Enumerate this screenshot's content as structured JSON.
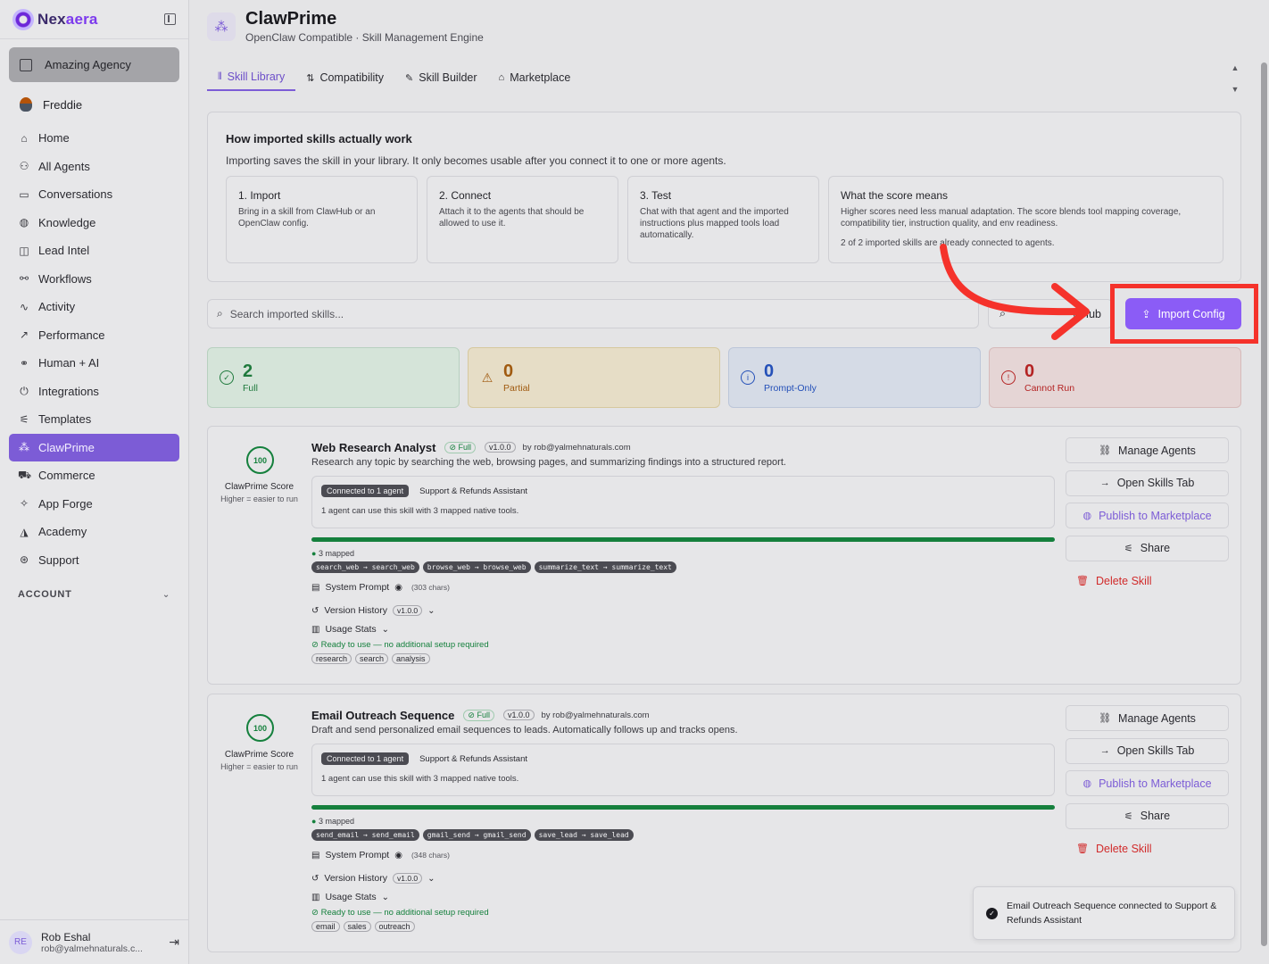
{
  "brand": {
    "name_part1": "Nex",
    "name_part2": "aera"
  },
  "workspace": "Amazing Agency",
  "user": "Freddie",
  "nav": [
    {
      "label": "Home",
      "icon": "⌂"
    },
    {
      "label": "All Agents",
      "icon": "⚇"
    },
    {
      "label": "Conversations",
      "icon": "▭"
    },
    {
      "label": "Knowledge",
      "icon": "◍"
    },
    {
      "label": "Lead Intel",
      "icon": "◫"
    },
    {
      "label": "Workflows",
      "icon": "⚯"
    },
    {
      "label": "Activity",
      "icon": "∿"
    },
    {
      "label": "Performance",
      "icon": "↗"
    },
    {
      "label": "Human + AI",
      "icon": "⚭"
    },
    {
      "label": "Integrations",
      "icon": "⏻"
    },
    {
      "label": "Templates",
      "icon": "⚟"
    },
    {
      "label": "ClawPrime",
      "icon": "⁂"
    },
    {
      "label": "Commerce",
      "icon": "⛟"
    },
    {
      "label": "App Forge",
      "icon": "✧"
    },
    {
      "label": "Academy",
      "icon": "◮"
    },
    {
      "label": "Support",
      "icon": "⊛"
    }
  ],
  "account_label": "ACCOUNT",
  "footer": {
    "initials": "RE",
    "name": "Rob Eshal",
    "email": "rob@yalmehnaturals.c..."
  },
  "page": {
    "title": "ClawPrime",
    "subtitle": "OpenClaw Compatible · Skill Management Engine"
  },
  "tabs": [
    "Skill Library",
    "Compatibility",
    "Skill Builder",
    "Marketplace"
  ],
  "info": {
    "title": "How imported skills actually work",
    "desc": "Importing saves the skill in your library. It only becomes usable after you connect it to one or more agents.",
    "steps": [
      {
        "title": "1. Import",
        "desc": "Bring in a skill from ClawHub or an OpenClaw config."
      },
      {
        "title": "2. Connect",
        "desc": "Attach it to the agents that should be allowed to use it."
      },
      {
        "title": "3. Test",
        "desc": "Chat with that agent and the imported instructions plus mapped tools load automatically."
      },
      {
        "title": "What the score means",
        "desc": "Higher scores need less manual adaptation. The score blends tool mapping coverage, compatibility tier, instruction quality, and env readiness.",
        "extra": "2 of 2 imported skills are already connected to agents."
      }
    ]
  },
  "search_placeholder": "Search imported skills...",
  "clawhub_label": "wHub",
  "import_label": "Import Config",
  "stats": [
    {
      "value": "2",
      "label": "Full"
    },
    {
      "value": "0",
      "label": "Partial"
    },
    {
      "value": "0",
      "label": "Prompt-Only"
    },
    {
      "value": "0",
      "label": "Cannot Run"
    }
  ],
  "skills": [
    {
      "score": "100",
      "score_label": "ClawPrime Score",
      "score_sub": "Higher = easier to run",
      "name": "Web Research Analyst",
      "tier": "Full",
      "version": "v1.0.0",
      "by": "by rob@yalmehnaturals.com",
      "desc": "Research any topic by searching the web, browsing pages, and summarizing findings into a structured report.",
      "connected": "Connected to 1 agent",
      "agent": "Support & Refunds Assistant",
      "note": "1 agent can use this skill with 3 mapped native tools.",
      "progress": 1.0,
      "mapped": "3 mapped",
      "tools": [
        "search_web → search_web",
        "browse_web → browse_web",
        "summarize_text → summarize_text"
      ],
      "system_prompt": "System Prompt",
      "chars": "(303 chars)",
      "version_history": "Version History",
      "usage_stats": "Usage Stats",
      "ready": "Ready to use — no additional setup required",
      "tags": [
        "research",
        "search",
        "analysis"
      ]
    },
    {
      "score": "100",
      "score_label": "ClawPrime Score",
      "score_sub": "Higher = easier to run",
      "name": "Email Outreach Sequence",
      "tier": "Full",
      "version": "v1.0.0",
      "by": "by rob@yalmehnaturals.com",
      "desc": "Draft and send personalized email sequences to leads. Automatically follows up and tracks opens.",
      "connected": "Connected to 1 agent",
      "agent": "Support & Refunds Assistant",
      "note": "1 agent can use this skill with 3 mapped native tools.",
      "progress": 1.0,
      "mapped": "3 mapped",
      "tools": [
        "send_email → send_email",
        "gmail_send → gmail_send",
        "save_lead → save_lead"
      ],
      "system_prompt": "System Prompt",
      "chars": "(348 chars)",
      "version_history": "Version History",
      "usage_stats": "Usage Stats",
      "ready": "Ready to use — no additional setup required",
      "tags": [
        "email",
        "sales",
        "outreach"
      ]
    }
  ],
  "actions": [
    "Manage Agents",
    "Open Skills Tab",
    "Publish to Marketplace",
    "Share",
    "Delete Skill"
  ],
  "toast": "Email Outreach Sequence connected to Support & Refunds Assistant"
}
